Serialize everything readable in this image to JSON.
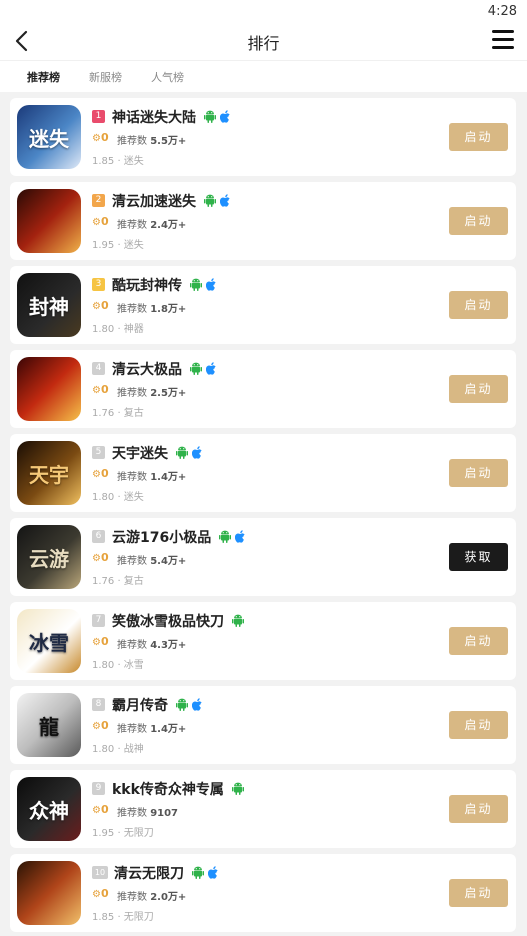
{
  "status": {
    "time": "4:28"
  },
  "header": {
    "title": "排行"
  },
  "tabs": [
    {
      "label": "推荐榜"
    },
    {
      "label": "新服榜"
    },
    {
      "label": "人气榜"
    }
  ],
  "colors": {
    "rank1": "#e94c6c",
    "rank2": "#f2a64b",
    "rank3": "#f6c443",
    "rank_other": "#cfcfcf",
    "start_button": "#d8b884",
    "get_button": "#1b1b1b"
  },
  "games": [
    {
      "rank": "1",
      "name": "神话迷失大陆",
      "android": true,
      "ios": true,
      "medal": "0",
      "rec_label": "推荐数",
      "rec_count": "5.5万+",
      "meta": "1.85 · 迷失",
      "button": "启动",
      "button_type": "start",
      "icon_text": "迷失"
    },
    {
      "rank": "2",
      "name": "清云加速迷失",
      "android": true,
      "ios": true,
      "medal": "0",
      "rec_label": "推荐数",
      "rec_count": "2.4万+",
      "meta": "1.95 · 迷失",
      "button": "启动",
      "button_type": "start",
      "icon_text": ""
    },
    {
      "rank": "3",
      "name": "酷玩封神传",
      "android": true,
      "ios": true,
      "medal": "0",
      "rec_label": "推荐数",
      "rec_count": "1.8万+",
      "meta": "1.80 · 神器",
      "button": "启动",
      "button_type": "start",
      "icon_text": "封神"
    },
    {
      "rank": "4",
      "name": "清云大极品",
      "android": true,
      "ios": true,
      "medal": "0",
      "rec_label": "推荐数",
      "rec_count": "2.5万+",
      "meta": "1.76 · 复古",
      "button": "启动",
      "button_type": "start",
      "icon_text": ""
    },
    {
      "rank": "5",
      "name": "天宇迷失",
      "android": true,
      "ios": true,
      "medal": "0",
      "rec_label": "推荐数",
      "rec_count": "1.4万+",
      "meta": "1.80 · 迷失",
      "button": "启动",
      "button_type": "start",
      "icon_text": "天宇"
    },
    {
      "rank": "6",
      "name": "云游176小极品",
      "android": true,
      "ios": true,
      "medal": "0",
      "rec_label": "推荐数",
      "rec_count": "5.4万+",
      "meta": "1.76 · 复古",
      "button": "获取",
      "button_type": "get",
      "icon_text": "云游"
    },
    {
      "rank": "7",
      "name": "笑傲冰雪极品快刀",
      "android": true,
      "ios": false,
      "medal": "0",
      "rec_label": "推荐数",
      "rec_count": "4.3万+",
      "meta": "1.80 · 冰雪",
      "button": "启动",
      "button_type": "start",
      "icon_text": "冰雪"
    },
    {
      "rank": "8",
      "name": "霸月传奇",
      "android": true,
      "ios": true,
      "medal": "0",
      "rec_label": "推荐数",
      "rec_count": "1.4万+",
      "meta": "1.80 · 战神",
      "button": "启动",
      "button_type": "start",
      "icon_text": "龍"
    },
    {
      "rank": "9",
      "name": "kkk传奇众神专属",
      "android": true,
      "ios": false,
      "medal": "0",
      "rec_label": "推荐数",
      "rec_count": "9107",
      "meta": "1.95 · 无限刀",
      "button": "启动",
      "button_type": "start",
      "icon_text": "众神"
    },
    {
      "rank": "10",
      "name": "清云无限刀",
      "android": true,
      "ios": true,
      "medal": "0",
      "rec_label": "推荐数",
      "rec_count": "2.0万+",
      "meta": "1.85 · 无限刀",
      "button": "启动",
      "button_type": "start",
      "icon_text": ""
    }
  ]
}
